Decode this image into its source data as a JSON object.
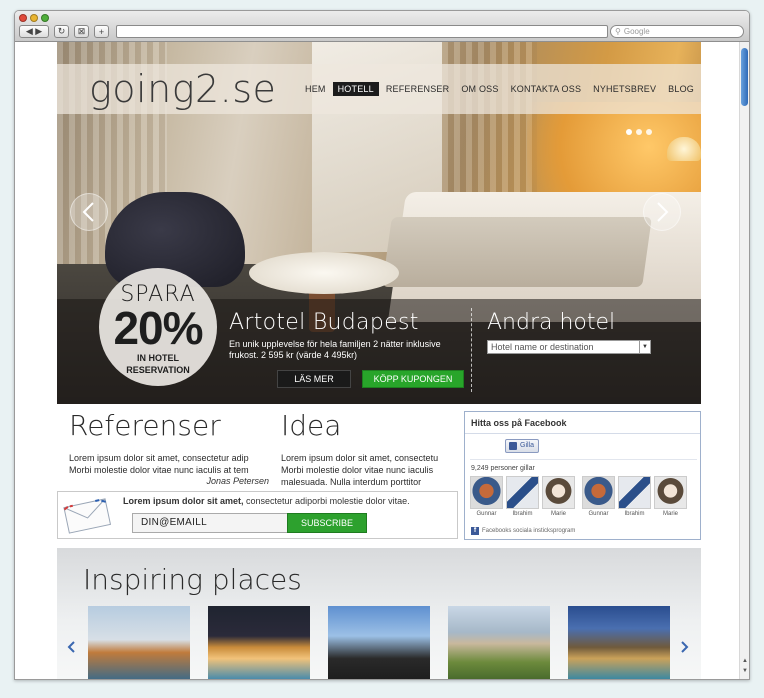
{
  "browser": {
    "search_placeholder": "Google"
  },
  "header": {
    "logo_text": "going2.se",
    "nav": [
      {
        "label": "HEM",
        "active": false
      },
      {
        "label": "HOTELL",
        "active": true
      },
      {
        "label": "REFERENSER",
        "active": false
      },
      {
        "label": "OM OSS",
        "active": false
      },
      {
        "label": "KONTAKTA OSS",
        "active": false
      },
      {
        "label": "NYHETSBREV",
        "active": false
      },
      {
        "label": "BLOG",
        "active": false
      }
    ]
  },
  "hero": {
    "promo": {
      "line1": "SPARA",
      "line2": "20%",
      "line3": "IN HOTEL",
      "line4": "RESERVATION"
    },
    "title": "Artotel Budapest",
    "description": "En unik upplevelse för hela familjen 2 nätter inklusive frukost. 2 595 kr  (värde 4 495kr)",
    "btn_more": "LÄS MER",
    "btn_buy": "KÖPP KUPONGEN",
    "other_title": "Andra hotel",
    "hotel_select_value": "Hotel name or destination",
    "slide_count": 3,
    "active_slide": 1
  },
  "referenser": {
    "title": "Referenser",
    "body": "Lorem ipsum dolor sit amet, consectetur adip Morbi molestie dolor vitae nunc iaculis at tem",
    "author": "Jonas Petersen"
  },
  "idea": {
    "title": "Idea",
    "body": "Lorem ipsum dolor sit amet, consectetu Morbi molestie dolor vitae nunc iaculis malesuada. Nulla interdum porttitor"
  },
  "newsletter": {
    "text_bold": "Lorem ipsum dolor sit amet,",
    "text_rest": " consectetur adiporbi molestie dolor vitae.",
    "email_value": "DIN@EMAILL",
    "subscribe_label": "SUBSCRIBE"
  },
  "facebook": {
    "title": "Hitta oss på Facebook",
    "like_label": "Gilla",
    "count_text": "9,249 personer gillar",
    "faces": [
      {
        "name": "Gunnar"
      },
      {
        "name": "Ibrahim"
      },
      {
        "name": "Marie"
      },
      {
        "name": "Gunnar"
      },
      {
        "name": "Ibrahim"
      },
      {
        "name": "Marie"
      }
    ],
    "footer": "Facebooks sociala insticksprogram"
  },
  "inspiring": {
    "title": "Inspiring places",
    "places_count": 5
  },
  "colors": {
    "accent_green": "#28a52a",
    "nav_active_bg": "#1c1c1c",
    "facebook_blue": "#3b5998"
  }
}
